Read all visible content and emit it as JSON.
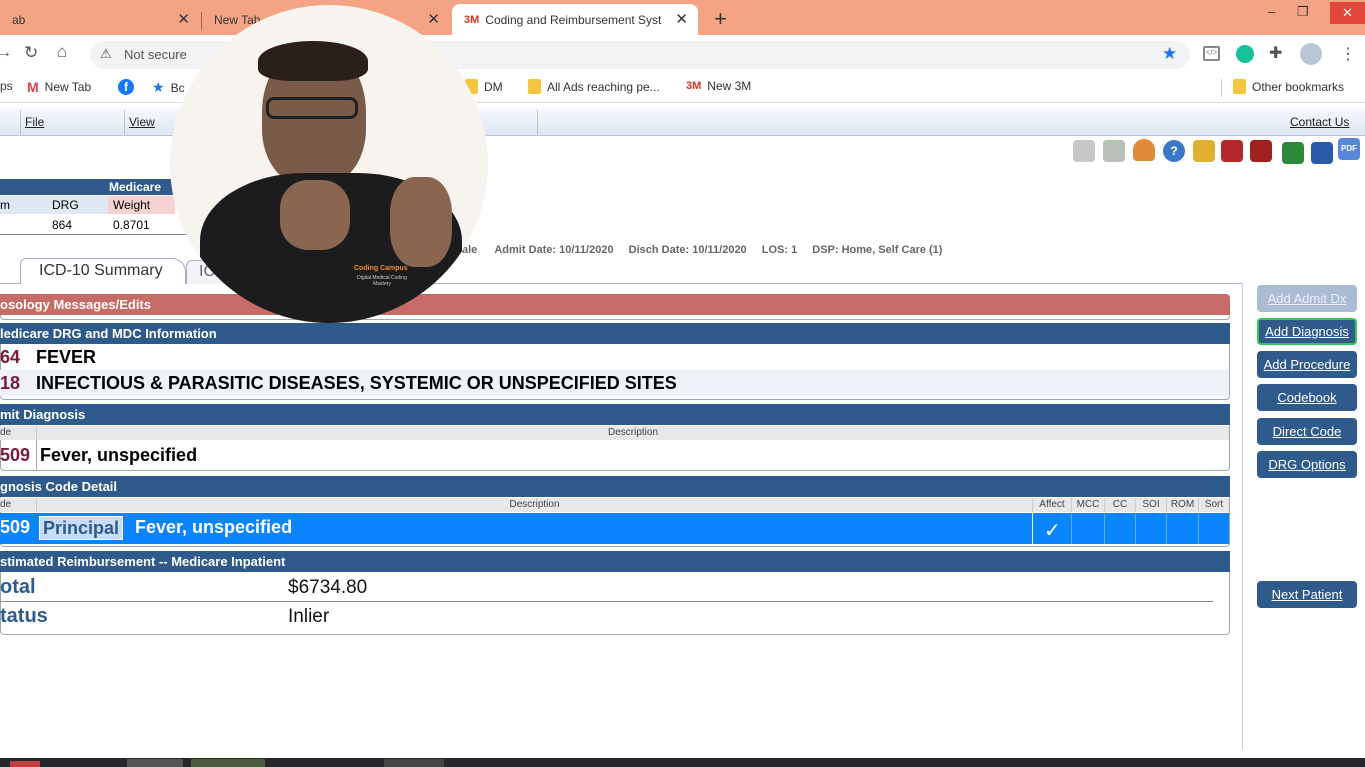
{
  "browser": {
    "tabs": [
      {
        "label": "ab",
        "close": "✕"
      },
      {
        "label": "New Tab",
        "close": "✕"
      },
      {
        "label": "Coding and Reimbursement Syst",
        "close": "✕",
        "favicon": "3M"
      }
    ],
    "new_tab": "+",
    "window_controls": [
      "–",
      "❐",
      "✕"
    ],
    "address": "Not secure",
    "bookmarks": [
      {
        "label": "ps"
      },
      {
        "label": "New Tab",
        "icon": "gmail-icon"
      },
      {
        "label": "",
        "icon": "facebook-icon"
      },
      {
        "label": "Bc",
        "icon": "star-icon"
      },
      {
        "label": "DM",
        "icon": "folder-icon"
      },
      {
        "label": "All Ads reaching pe...",
        "icon": "folder-icon"
      },
      {
        "label": "New 3M",
        "icon": "3m-icon"
      },
      {
        "label": "Other bookmarks",
        "icon": "folder-icon"
      }
    ]
  },
  "app": {
    "menu": {
      "file": "File",
      "view": "View",
      "contact": "Contact Us"
    },
    "drg_table": {
      "header": "Medicare",
      "col_m": "m",
      "col_drg": "DRG",
      "col_weight": "Weight",
      "drg": "864",
      "weight": "0.8701"
    },
    "patient_info": {
      "sex": "ale",
      "admit": "Admit Date: 10/11/2020",
      "disch": "Disch Date: 10/11/2020",
      "los": "LOS: 1",
      "dsp": "DSP: Home, Self Care (1)"
    },
    "tabs": {
      "summary": "ICD-10 Summary",
      "other": "IC"
    },
    "sections": {
      "nosology": "osology Messages/Edits",
      "drg_mdc": "ledicare DRG and MDC Information",
      "admit_dx": "mit Diagnosis",
      "dx_detail": "gnosis Code Detail",
      "reimb": "stimated Reimbursement -- Medicare Inpatient"
    },
    "drg_rows": [
      {
        "code": "64",
        "desc": "FEVER"
      },
      {
        "code": "18",
        "desc": "INFECTIOUS & PARASITIC DISEASES, SYSTEMIC OR UNSPECIFIED SITES"
      }
    ],
    "admit_dx": {
      "col_code": "de",
      "col_desc": "Description",
      "code": "509",
      "desc": "Fever, unspecified"
    },
    "dx_detail": {
      "col_code": "de",
      "col_desc": "Description",
      "cols": [
        "Affect",
        "MCC",
        "CC",
        "SOI",
        "ROM",
        "Sort"
      ],
      "code": "509",
      "badge": "Principal",
      "desc": "Fever, unspecified",
      "check": "✓"
    },
    "reimb": {
      "total_label": "otal",
      "total_value": "$6734.80",
      "status_label": "tatus",
      "status_value": "Inlier"
    },
    "buttons": {
      "add_admit_dx": "Add Admit Dx",
      "add_diagnosis": "Add Diagnosis",
      "add_procedure": "Add Procedure",
      "codebook": "Codebook",
      "direct_code": "Direct Code",
      "drg_options": "DRG Options",
      "next_patient": "Next Patient"
    },
    "overlay": {
      "shirt_text": "Coding Campus",
      "shirt_sub": "Digital Medical Coding Mastery"
    }
  },
  "colors": {
    "tabstrip": "#f4a484",
    "section": "#2f5a8c",
    "nosology": "#c76b66",
    "selected_row": "#0a84ff"
  }
}
